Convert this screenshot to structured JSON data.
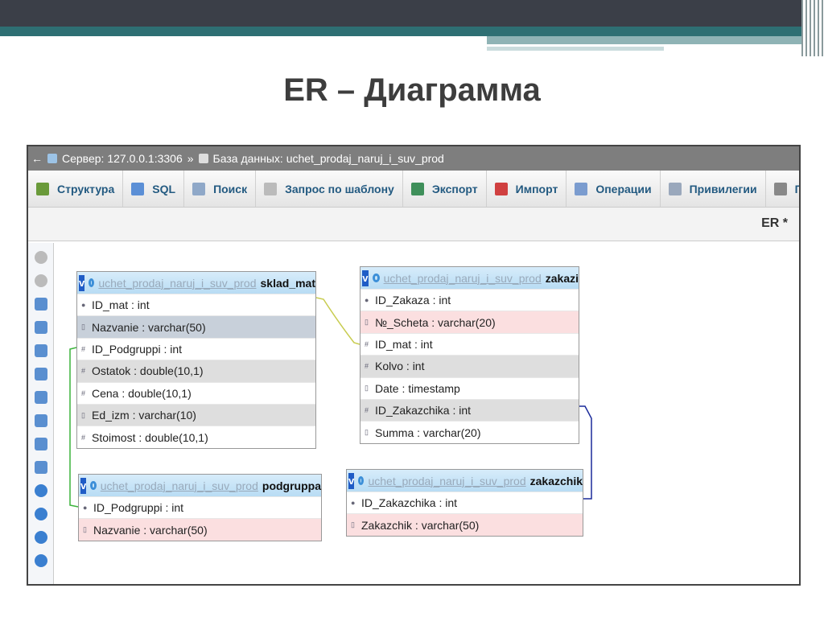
{
  "slide": {
    "title": "ER – Диаграмма"
  },
  "breadcrumb": {
    "back": "←",
    "server": "Сервер: 127.0.0.1:3306",
    "sep": "»",
    "database": "База данных: uchet_prodaj_naruj_i_suv_prod"
  },
  "toolbar": [
    {
      "label": "Структура",
      "icon": "structure-icon",
      "color": "#6a9a3a"
    },
    {
      "label": "SQL",
      "icon": "sql-icon",
      "color": "#5b8fd6"
    },
    {
      "label": "Поиск",
      "icon": "search-icon",
      "color": "#8fa8c8"
    },
    {
      "label": "Запрос по шаблону",
      "icon": "query-icon",
      "color": "#bbbbbb"
    },
    {
      "label": "Экспорт",
      "icon": "export-icon",
      "color": "#3f8f5a"
    },
    {
      "label": "Импорт",
      "icon": "import-icon",
      "color": "#d04040"
    },
    {
      "label": "Операции",
      "icon": "wrench-icon",
      "color": "#7b9ccf"
    },
    {
      "label": "Привилегии",
      "icon": "privileges-icon",
      "color": "#9aa8bc"
    },
    {
      "label": "Пр",
      "icon": "routines-icon",
      "color": "#888888"
    }
  ],
  "er_tab": "ER *",
  "tables": [
    {
      "db": "uchet_prodaj_naruj_i_suv_prod",
      "name": "sklad_mat",
      "v": "v",
      "cols": [
        {
          "k": "key",
          "t": "ID_mat : int",
          "bg": ""
        },
        {
          "k": "text",
          "t": "Nazvanie : varchar(50)",
          "bg": "b"
        },
        {
          "k": "num",
          "t": "ID_Podgruppi : int",
          "bg": ""
        },
        {
          "k": "num",
          "t": "Ostatok : double(10,1)",
          "bg": "g"
        },
        {
          "k": "num",
          "t": "Cena : double(10,1)",
          "bg": ""
        },
        {
          "k": "text",
          "t": "Ed_izm : varchar(10)",
          "bg": "g"
        },
        {
          "k": "num",
          "t": "Stoimost : double(10,1)",
          "bg": ""
        }
      ]
    },
    {
      "db": "uchet_prodaj_naruj_i_suv_prod",
      "name": "zakazi",
      "v": "v",
      "cols": [
        {
          "k": "key",
          "t": "ID_Zakaza : int",
          "bg": ""
        },
        {
          "k": "text",
          "t": "№_Scheta : varchar(20)",
          "bg": "p"
        },
        {
          "k": "num",
          "t": "ID_mat : int",
          "bg": ""
        },
        {
          "k": "num",
          "t": "Kolvo : int",
          "bg": "g"
        },
        {
          "k": "date",
          "t": "Date : timestamp",
          "bg": ""
        },
        {
          "k": "num",
          "t": "ID_Zakazchika : int",
          "bg": "g"
        },
        {
          "k": "text",
          "t": "Summa : varchar(20)",
          "bg": ""
        }
      ]
    },
    {
      "db": "uchet_prodaj_naruj_i_suv_prod",
      "name": "podgruppa",
      "v": "v",
      "cols": [
        {
          "k": "key",
          "t": "ID_Podgruppi : int",
          "bg": ""
        },
        {
          "k": "text",
          "t": "Nazvanie : varchar(50)",
          "bg": "p"
        }
      ]
    },
    {
      "db": "uchet_prodaj_naruj_i_suv_prod",
      "name": "zakazchik",
      "v": "v",
      "cols": [
        {
          "k": "key",
          "t": "ID_Zakazchika : int",
          "bg": ""
        },
        {
          "k": "text",
          "t": "Zakazchik : varchar(50)",
          "bg": "p"
        }
      ]
    }
  ]
}
